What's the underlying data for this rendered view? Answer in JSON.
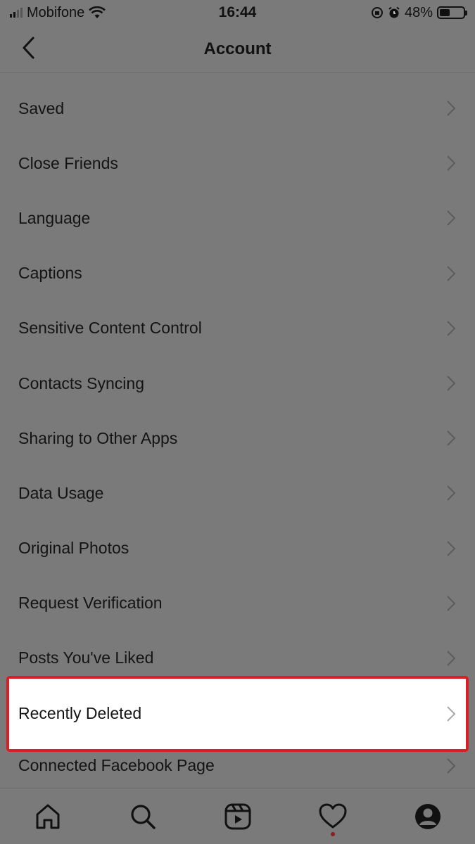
{
  "status_bar": {
    "carrier": "Mobifone",
    "time": "16:44",
    "battery": "48%"
  },
  "header": {
    "title": "Account"
  },
  "menu": {
    "items": [
      {
        "label": "Saved"
      },
      {
        "label": "Close Friends"
      },
      {
        "label": "Language"
      },
      {
        "label": "Captions"
      },
      {
        "label": "Sensitive Content Control"
      },
      {
        "label": "Contacts Syncing"
      },
      {
        "label": "Sharing to Other Apps"
      },
      {
        "label": "Data Usage"
      },
      {
        "label": "Original Photos"
      },
      {
        "label": "Request Verification"
      },
      {
        "label": "Posts You've Liked"
      },
      {
        "label": "Recently Deleted"
      },
      {
        "label": "Connected Facebook Page"
      }
    ]
  },
  "colors": {
    "overlay_bg": "#7a7a7a",
    "highlight_border": "#d91f26",
    "highlight_bg": "#ffffff"
  },
  "tab_bar": {
    "tabs": [
      "home-icon",
      "search-icon",
      "reels-icon",
      "activity-heart-icon",
      "profile-icon"
    ]
  }
}
